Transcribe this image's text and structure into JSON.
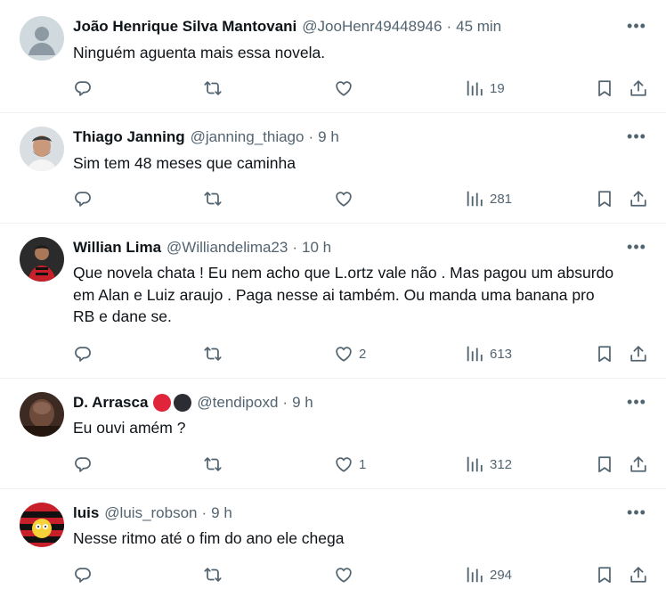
{
  "tweets": [
    {
      "name": "João Henrique Silva Mantovani",
      "handle": "@JooHenr49448946",
      "dot": "·",
      "time": "45 min",
      "text": "Ninguém aguenta mais essa novela.",
      "replies": "",
      "retweets": "",
      "likes": "",
      "views": "19"
    },
    {
      "name": "Thiago Janning",
      "handle": "@janning_thiago",
      "dot": "·",
      "time": "9 h",
      "text": "Sim tem 48 meses que caminha",
      "replies": "",
      "retweets": "",
      "likes": "",
      "views": "281"
    },
    {
      "name": "Willian Lima",
      "handle": "@Williandelima23",
      "dot": "·",
      "time": "10 h",
      "text": "Que novela chata ! Eu nem acho que L.ortz vale não . Mas pagou um absurdo em Alan e Luiz araujo . Paga nesse ai também.  Ou manda uma banana pro RB e dane se.",
      "replies": "",
      "retweets": "",
      "likes": "2",
      "views": "613"
    },
    {
      "name": "D. Arrasca",
      "handle": "@tendipoxd",
      "dot": "·",
      "time": "9 h",
      "text": "Eu ouvi amém ?",
      "replies": "",
      "retweets": "",
      "likes": "1",
      "views": "312",
      "badge_colors": [
        "#e0243a",
        "#2b2d33"
      ]
    },
    {
      "name": "luis",
      "handle": "@luis_robson",
      "dot": "·",
      "time": "9 h",
      "text": "Nesse ritmo até o fim do ano ele chega",
      "replies": "",
      "retweets": "",
      "likes": "",
      "views": "294"
    }
  ],
  "more_symbol": "•••",
  "icons": [
    "reply-icon",
    "retweet-icon",
    "like-icon",
    "views-icon",
    "bookmark-icon",
    "share-icon",
    "more-icon"
  ],
  "colors": {
    "text": "#0f1419",
    "secondary": "#536471",
    "divider": "#eff3f4"
  }
}
